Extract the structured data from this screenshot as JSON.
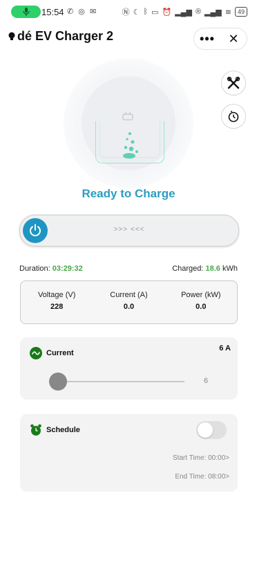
{
  "status_bar": {
    "time": "15:54",
    "battery": "49",
    "icons": [
      "call-icon",
      "whatsapp-icon",
      "mail-icon",
      "nfc-icon",
      "moon-icon",
      "bluetooth-icon",
      "vibrate-icon",
      "alarm-icon",
      "signal-icon",
      "registered-icon",
      "signal-icon",
      "wifi-icon"
    ]
  },
  "header": {
    "title": "dé EV Charger 2",
    "more_label": "•••",
    "close_label": "✕"
  },
  "hero": {
    "status": "Ready to Charge",
    "accent": "#2b9ec0"
  },
  "power_slider": {
    "hint": ">>> <<<"
  },
  "info": {
    "duration_label": "Duration:",
    "duration_value": "03:29:32",
    "charged_label": "Charged:",
    "charged_value": "18.6",
    "charged_unit": "kWh"
  },
  "metrics": [
    {
      "label": "Voltage (V)",
      "value": "228"
    },
    {
      "label": "Current (A)",
      "value": "0.0"
    },
    {
      "label": "Power (kW)",
      "value": "0.0"
    }
  ],
  "current_card": {
    "title": "Current",
    "amp_label": "6 A",
    "slider_value": "6"
  },
  "schedule_card": {
    "title": "Schedule",
    "toggle_on": false,
    "start_time": "Start Time: 00:00>",
    "end_time": "End Time: 08:00>"
  },
  "colors": {
    "green": "#47a84a",
    "accent_blue": "#1f96c2",
    "bubble_teal": "#5dd0b4"
  }
}
